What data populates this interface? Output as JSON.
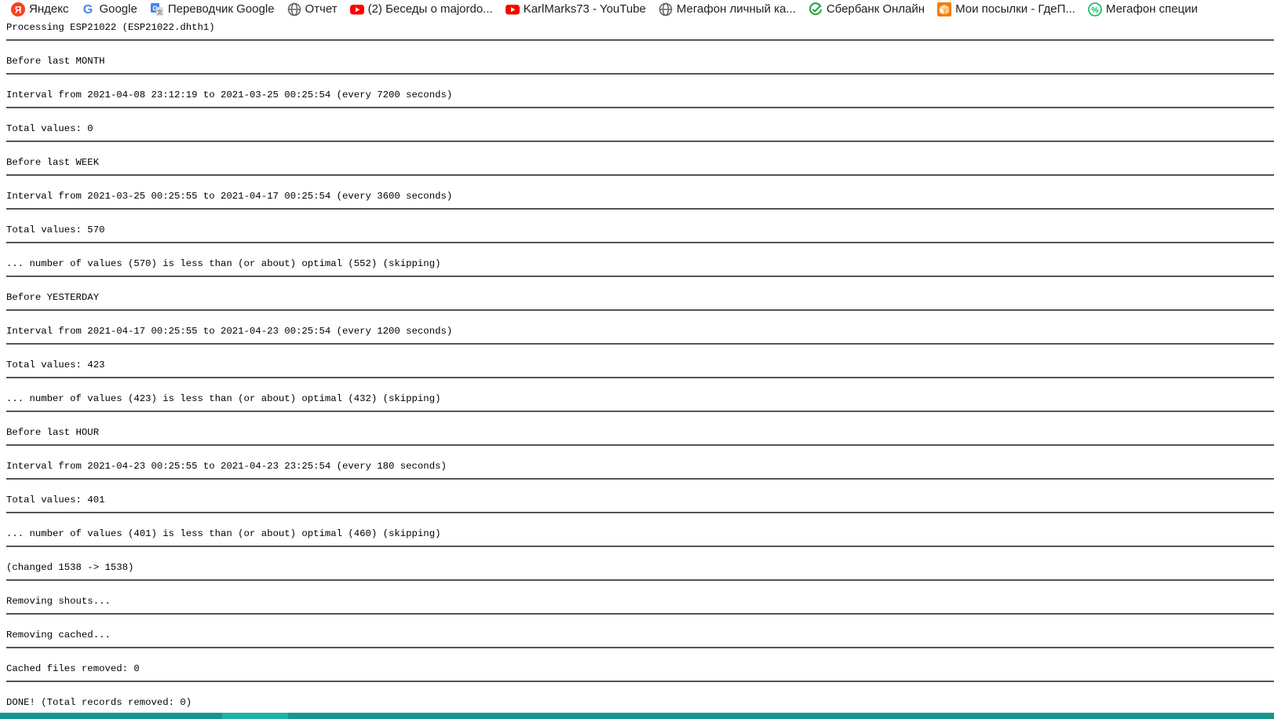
{
  "bookmarks": [
    {
      "label": "Яндекс",
      "icon": "yandex-icon"
    },
    {
      "label": "Google",
      "icon": "google-icon"
    },
    {
      "label": "Переводчик Google",
      "icon": "google-translate-icon"
    },
    {
      "label": "Отчет",
      "icon": "globe-icon"
    },
    {
      "label": "(2) Беседы о majordo...",
      "icon": "youtube-icon"
    },
    {
      "label": "KarlMarks73 - YouTube",
      "icon": "youtube-icon"
    },
    {
      "label": "Мегафон личный ка...",
      "icon": "globe-icon"
    },
    {
      "label": "Сбербанк Онлайн",
      "icon": "sberbank-icon"
    },
    {
      "label": "Мои посылки - ГдеП...",
      "icon": "parcel-icon"
    },
    {
      "label": "Мегафон специи",
      "icon": "percent-icon"
    }
  ],
  "log": [
    "Processing ESP21022 (ESP21022.dhth1)",
    "Before last MONTH",
    "Interval from 2021-04-08 23:12:19 to 2021-03-25 00:25:54 (every 7200 seconds)",
    "Total values: 0",
    "Before last WEEK",
    "Interval from 2021-03-25 00:25:55 to 2021-04-17 00:25:54 (every 3600 seconds)",
    "Total values: 570",
    "... number of values (570) is less than (or about) optimal (552) (skipping)",
    "Before YESTERDAY",
    "Interval from 2021-04-17 00:25:55 to 2021-04-23 00:25:54 (every 1200 seconds)",
    "Total values: 423",
    "... number of values (423) is less than (or about) optimal (432) (skipping)",
    "Before last HOUR",
    "Interval from 2021-04-23 00:25:55 to 2021-04-23 23:25:54 (every 180 seconds)",
    "Total values: 401",
    "... number of values (401) is less than (or about) optimal (460) (skipping)",
    "(changed 1538 -> 1538)",
    "Removing shouts...",
    "Removing cached...",
    "Cached files removed: 0",
    "DONE! (Total records removed: 0)"
  ],
  "colors": {
    "youtube": "#ff0000",
    "google_blue": "#4285f4",
    "sber_green": "#21a038",
    "parcel_orange": "#f57c00",
    "megafon_green": "#00b956",
    "bottom_bar": "#17968f"
  }
}
